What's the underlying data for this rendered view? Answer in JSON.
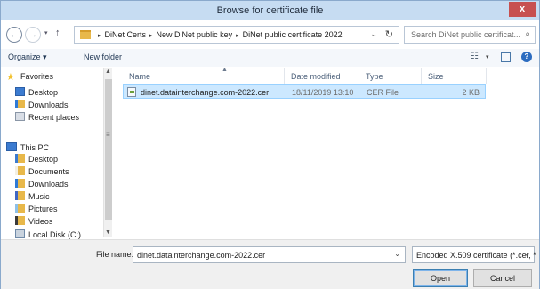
{
  "window": {
    "title": "Browse for certificate file",
    "close_label": "x"
  },
  "nav": {
    "back_glyph": "←",
    "forward_glyph": "→",
    "recent_glyph": "▾",
    "up_glyph": "↑",
    "breadcrumbs": [
      "DiNet Certs",
      "New DiNet public key",
      "DiNet public certificate 2022"
    ],
    "crumb_separator": "▸",
    "address_dropdown_glyph": "⌄",
    "refresh_glyph": "↻",
    "search_placeholder": "Search DiNet public certificat...",
    "search_glyph": "⌕"
  },
  "toolbar": {
    "organize_label": "Organize ▾",
    "new_folder_label": "New folder",
    "views_glyph": "☷",
    "views_drop_glyph": "▾",
    "help_glyph": "?"
  },
  "sidebar": {
    "favorites_label": "Favorites",
    "favorites_items": [
      "Desktop",
      "Downloads",
      "Recent places"
    ],
    "thispc_label": "This PC",
    "thispc_items": [
      "Desktop",
      "Documents",
      "Downloads",
      "Music",
      "Pictures",
      "Videos",
      "Local Disk (C:)"
    ]
  },
  "scrollbar": {
    "up_glyph": "▲",
    "down_glyph": "▼",
    "grip_glyph": "≡"
  },
  "columns": {
    "name": "Name",
    "date": "Date modified",
    "type": "Type",
    "size": "Size",
    "sort_glyph": "▲"
  },
  "files": [
    {
      "name": "dinet.datainterchange.com-2022.cer",
      "date": "18/11/2019 13:10",
      "type": "CER File",
      "size": "2 KB"
    }
  ],
  "bottom": {
    "filename_label": "File name:",
    "filename_value": "dinet.datainterchange.com-2022.cer",
    "filename_drop_glyph": "⌄",
    "filter_value": "Encoded X.509 certificate (*.cer, *",
    "filter_drop_glyph": "⌄",
    "open_label": "Open",
    "cancel_label": "Cancel"
  },
  "colors": {
    "titlebar": "#c6dcf2",
    "close_button": "#c75050",
    "selection": "#cce8ff",
    "favorites_star": "#f2c230",
    "folder": "#e8b84a"
  }
}
